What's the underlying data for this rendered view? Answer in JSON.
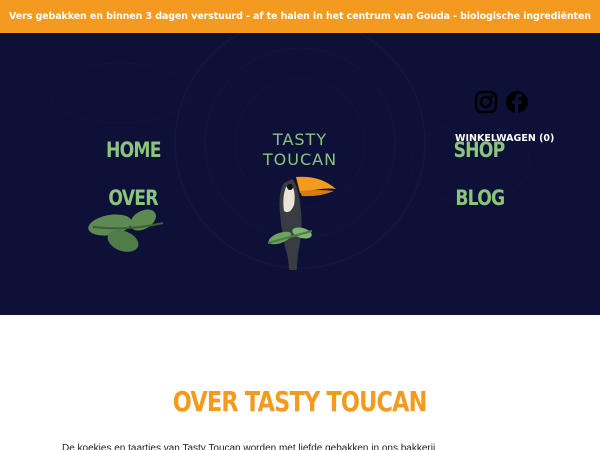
{
  "announcement": {
    "text": "Vers gebakken en binnen 3 dagen verstuurd - af te halen in het centrum van Gouda - biologische ingrediënten"
  },
  "nav": {
    "home": "HOME",
    "over": "OVER",
    "shop": "SHOP",
    "blog": "BLOG"
  },
  "logo": {
    "line1": "TASTY",
    "line2": "TOUCAN"
  },
  "header": {
    "cart_label": "WINKELWAGEN (0)",
    "social": [
      "instagram-icon",
      "facebook-icon"
    ]
  },
  "about": {
    "title": "OVER TASTY TOUCAN",
    "intro": "De koekjes en taartjes van Tasty Toucan worden met liefde gebakken in ons bakkerij"
  },
  "colors": {
    "accent_orange": "#f39a1f",
    "hero_navy": "#0d1037",
    "nav_green": "#8bc57c"
  }
}
